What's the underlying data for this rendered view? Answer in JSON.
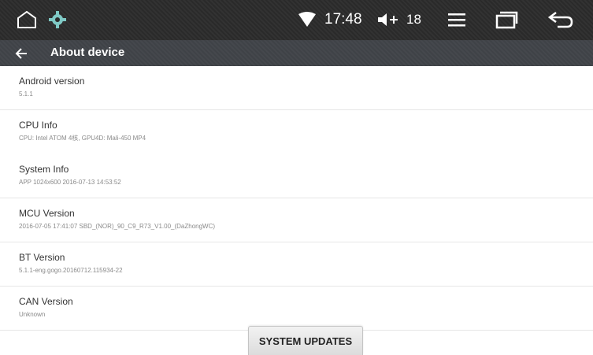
{
  "statusbar": {
    "time": "17:48",
    "volume": "18",
    "icons": [
      "home-icon",
      "gear-icon",
      "wifi-icon",
      "volume-icon",
      "menu-icon",
      "recents-icon",
      "back-icon"
    ]
  },
  "header": {
    "title": "About device"
  },
  "items": [
    {
      "label": "Android version",
      "value": "5.1.1"
    },
    {
      "label": "CPU Info",
      "value": "CPU: Intel ATOM 4核, GPU4D: Mali-450 MP4"
    },
    {
      "label": "System Info",
      "value": "APP 1024x600 2016-07-13 14:53:52"
    },
    {
      "label": "MCU Version",
      "value": "2016-07-05 17:41:07 SBD_(NOR)_90_C9_R73_V1.00_(DaZhongWC)"
    },
    {
      "label": "BT Version",
      "value": "5.1.1-eng.gogo.20160712.115934-22"
    },
    {
      "label": "CAN Version",
      "value": "Unknown"
    }
  ],
  "footer": {
    "button_label": "SYSTEM UPDATES"
  },
  "colors": {
    "statusbar_bg": "#2a2a2a",
    "titlebar_bg": "#3f4247",
    "background": "#ffffff"
  }
}
